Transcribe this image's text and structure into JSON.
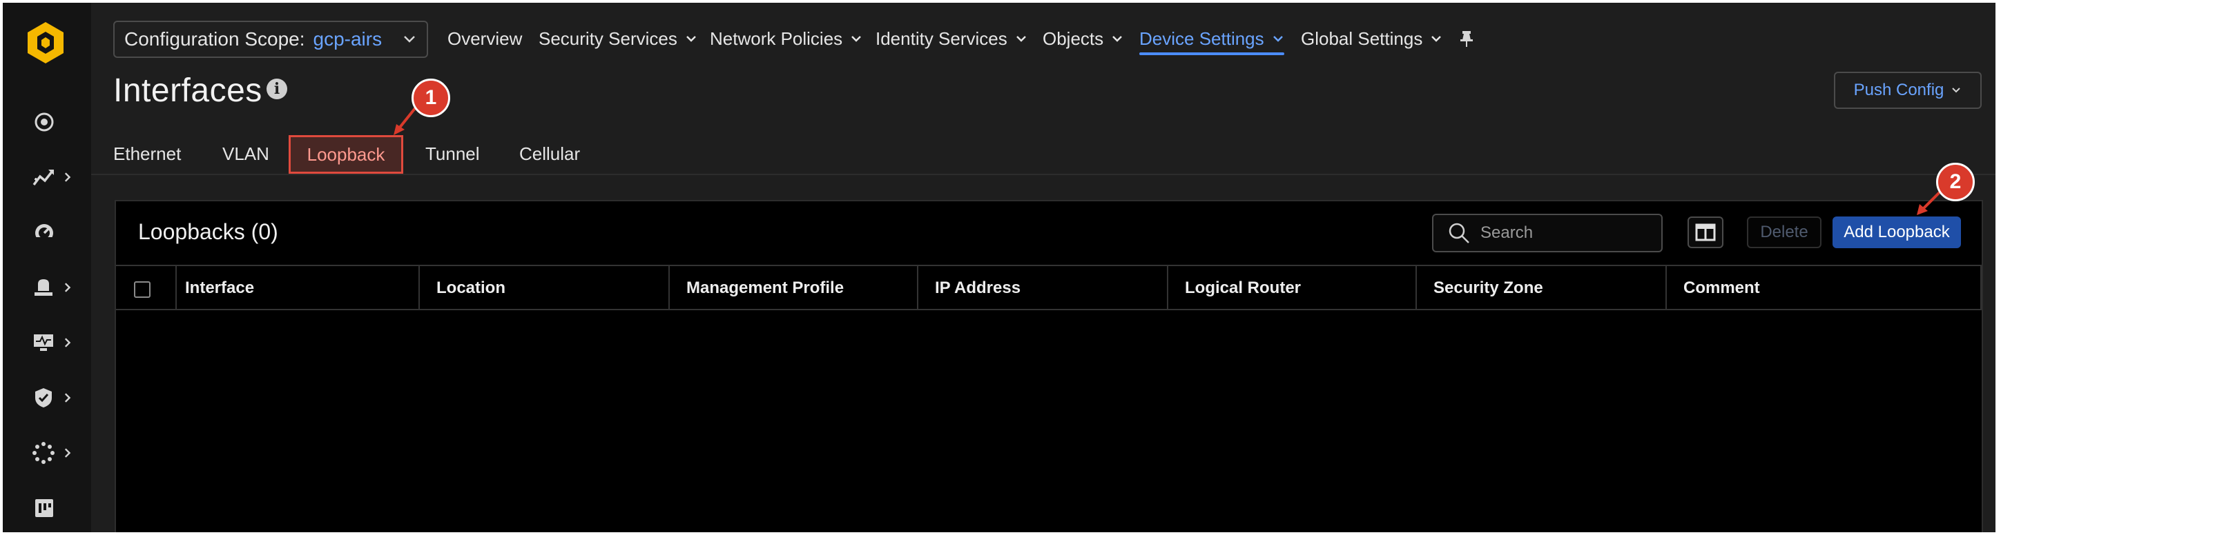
{
  "nav": {
    "scope_label": "Configuration Scope:",
    "scope_value": "gcp-airs",
    "items": [
      {
        "label": "Overview",
        "has_menu": false
      },
      {
        "label": "Security Services",
        "has_menu": true
      },
      {
        "label": "Network Policies",
        "has_menu": true
      },
      {
        "label": "Identity Services",
        "has_menu": true
      },
      {
        "label": "Objects",
        "has_menu": true
      },
      {
        "label": "Device Settings",
        "has_menu": true,
        "active": true
      },
      {
        "label": "Global Settings",
        "has_menu": true
      }
    ]
  },
  "rail": {
    "items": [
      {
        "icon": "target-icon",
        "has_submenu": false
      },
      {
        "icon": "analytics-icon",
        "has_submenu": true
      },
      {
        "icon": "dashboard-gauge-icon",
        "has_submenu": false
      },
      {
        "icon": "alarm-bell-icon",
        "has_submenu": true
      },
      {
        "icon": "monitor-icon",
        "has_submenu": true
      },
      {
        "icon": "shield-check-icon",
        "has_submenu": true
      },
      {
        "icon": "settings-dots-icon",
        "has_submenu": true
      },
      {
        "icon": "workflows-icon",
        "has_submenu": false
      }
    ]
  },
  "page": {
    "title": "Interfaces",
    "push_config_label": "Push Config"
  },
  "tabs": [
    {
      "label": "Ethernet"
    },
    {
      "label": "VLAN"
    },
    {
      "label": "Loopback",
      "active": true
    },
    {
      "label": "Tunnel"
    },
    {
      "label": "Cellular"
    }
  ],
  "panel": {
    "title": "Loopbacks (0)",
    "search_placeholder": "Search",
    "delete_label": "Delete",
    "add_label": "Add Loopback",
    "columns": [
      "Interface",
      "Location",
      "Management Profile",
      "IP Address",
      "Logical Router",
      "Security Zone",
      "Comment"
    ]
  },
  "annotations": {
    "step1": "1",
    "step2": "2"
  },
  "colors": {
    "accent": "#4c8dff",
    "primary_button": "#1f4fa8",
    "annotation": "#d93a2b",
    "logo": "#f5b800"
  }
}
